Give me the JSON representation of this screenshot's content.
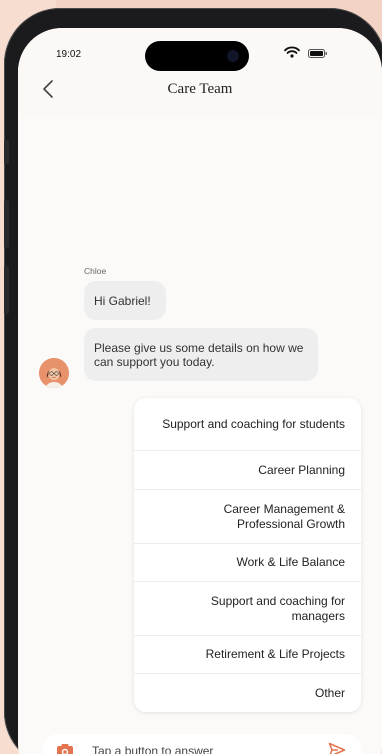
{
  "status_bar": {
    "time": "19:02"
  },
  "header": {
    "title": "Care Team"
  },
  "chat": {
    "sender": "Chloe",
    "messages": [
      {
        "text": "Hi Gabriel!"
      },
      {
        "text": "Please give us some details on how we can support you today."
      }
    ]
  },
  "options": [
    {
      "label": "Support and coaching for students"
    },
    {
      "label": "Career Planning"
    },
    {
      "label": "Career Management & Professional Growth"
    },
    {
      "label": "Work & Life Balance"
    },
    {
      "label": "Support and coaching for managers"
    },
    {
      "label": "Retirement & Life Projects"
    },
    {
      "label": "Other"
    }
  ],
  "composer": {
    "placeholder": "Tap a button to answer"
  },
  "colors": {
    "accent": "#e4734f",
    "bubble": "#eeeeee",
    "background": "#f6ddd0",
    "screen": "#fbfaf8"
  }
}
